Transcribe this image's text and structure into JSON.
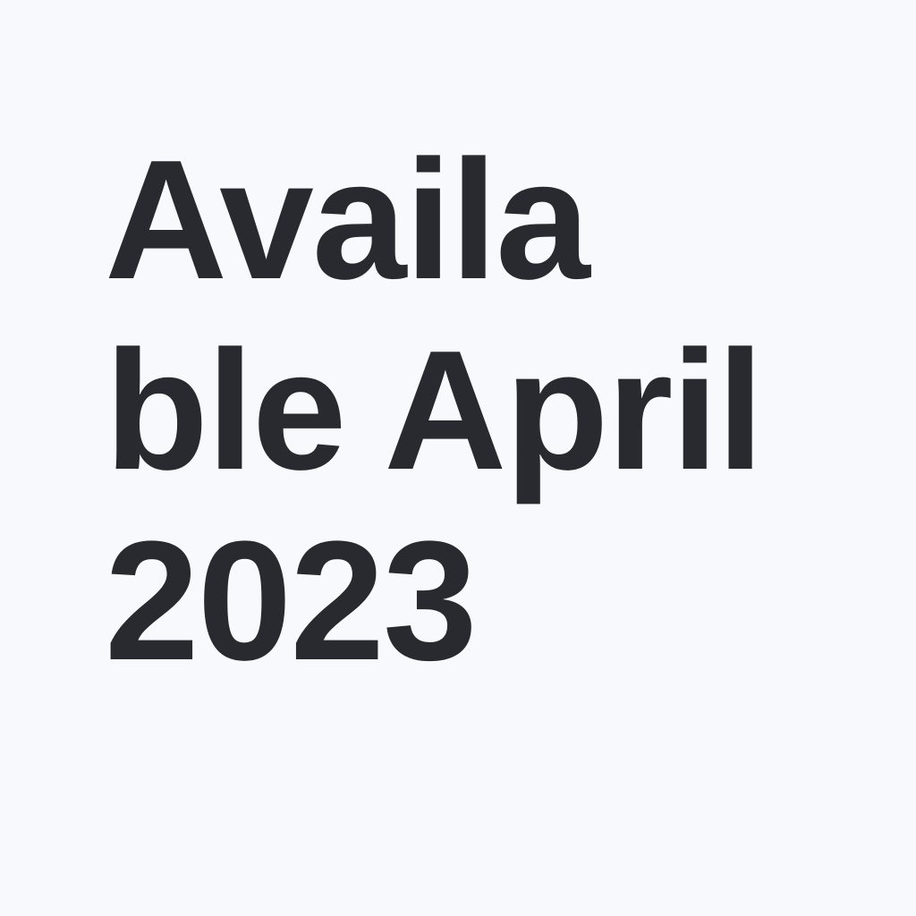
{
  "background_color": "#f8f9fd",
  "text_color": "#282a2f",
  "headline": {
    "lines": [
      "Availa",
      "ble April",
      "2023"
    ]
  }
}
